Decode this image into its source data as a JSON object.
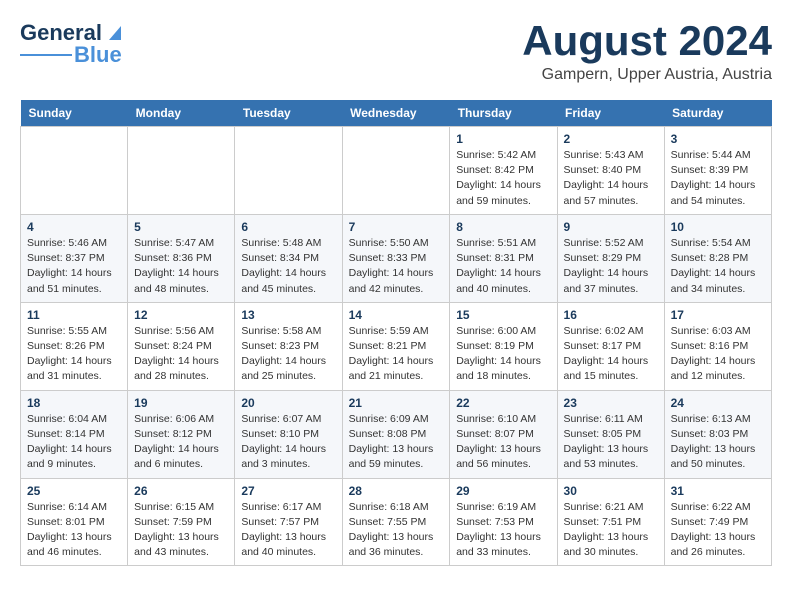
{
  "header": {
    "logo_general": "General",
    "logo_blue": "Blue",
    "month_title": "August 2024",
    "location": "Gampern, Upper Austria, Austria"
  },
  "calendar": {
    "weekdays": [
      "Sunday",
      "Monday",
      "Tuesday",
      "Wednesday",
      "Thursday",
      "Friday",
      "Saturday"
    ],
    "weeks": [
      [
        {
          "day": "",
          "sunrise": "",
          "sunset": "",
          "daylight": ""
        },
        {
          "day": "",
          "sunrise": "",
          "sunset": "",
          "daylight": ""
        },
        {
          "day": "",
          "sunrise": "",
          "sunset": "",
          "daylight": ""
        },
        {
          "day": "",
          "sunrise": "",
          "sunset": "",
          "daylight": ""
        },
        {
          "day": "1",
          "sunrise": "Sunrise: 5:42 AM",
          "sunset": "Sunset: 8:42 PM",
          "daylight": "Daylight: 14 hours and 59 minutes."
        },
        {
          "day": "2",
          "sunrise": "Sunrise: 5:43 AM",
          "sunset": "Sunset: 8:40 PM",
          "daylight": "Daylight: 14 hours and 57 minutes."
        },
        {
          "day": "3",
          "sunrise": "Sunrise: 5:44 AM",
          "sunset": "Sunset: 8:39 PM",
          "daylight": "Daylight: 14 hours and 54 minutes."
        }
      ],
      [
        {
          "day": "4",
          "sunrise": "Sunrise: 5:46 AM",
          "sunset": "Sunset: 8:37 PM",
          "daylight": "Daylight: 14 hours and 51 minutes."
        },
        {
          "day": "5",
          "sunrise": "Sunrise: 5:47 AM",
          "sunset": "Sunset: 8:36 PM",
          "daylight": "Daylight: 14 hours and 48 minutes."
        },
        {
          "day": "6",
          "sunrise": "Sunrise: 5:48 AM",
          "sunset": "Sunset: 8:34 PM",
          "daylight": "Daylight: 14 hours and 45 minutes."
        },
        {
          "day": "7",
          "sunrise": "Sunrise: 5:50 AM",
          "sunset": "Sunset: 8:33 PM",
          "daylight": "Daylight: 14 hours and 42 minutes."
        },
        {
          "day": "8",
          "sunrise": "Sunrise: 5:51 AM",
          "sunset": "Sunset: 8:31 PM",
          "daylight": "Daylight: 14 hours and 40 minutes."
        },
        {
          "day": "9",
          "sunrise": "Sunrise: 5:52 AM",
          "sunset": "Sunset: 8:29 PM",
          "daylight": "Daylight: 14 hours and 37 minutes."
        },
        {
          "day": "10",
          "sunrise": "Sunrise: 5:54 AM",
          "sunset": "Sunset: 8:28 PM",
          "daylight": "Daylight: 14 hours and 34 minutes."
        }
      ],
      [
        {
          "day": "11",
          "sunrise": "Sunrise: 5:55 AM",
          "sunset": "Sunset: 8:26 PM",
          "daylight": "Daylight: 14 hours and 31 minutes."
        },
        {
          "day": "12",
          "sunrise": "Sunrise: 5:56 AM",
          "sunset": "Sunset: 8:24 PM",
          "daylight": "Daylight: 14 hours and 28 minutes."
        },
        {
          "day": "13",
          "sunrise": "Sunrise: 5:58 AM",
          "sunset": "Sunset: 8:23 PM",
          "daylight": "Daylight: 14 hours and 25 minutes."
        },
        {
          "day": "14",
          "sunrise": "Sunrise: 5:59 AM",
          "sunset": "Sunset: 8:21 PM",
          "daylight": "Daylight: 14 hours and 21 minutes."
        },
        {
          "day": "15",
          "sunrise": "Sunrise: 6:00 AM",
          "sunset": "Sunset: 8:19 PM",
          "daylight": "Daylight: 14 hours and 18 minutes."
        },
        {
          "day": "16",
          "sunrise": "Sunrise: 6:02 AM",
          "sunset": "Sunset: 8:17 PM",
          "daylight": "Daylight: 14 hours and 15 minutes."
        },
        {
          "day": "17",
          "sunrise": "Sunrise: 6:03 AM",
          "sunset": "Sunset: 8:16 PM",
          "daylight": "Daylight: 14 hours and 12 minutes."
        }
      ],
      [
        {
          "day": "18",
          "sunrise": "Sunrise: 6:04 AM",
          "sunset": "Sunset: 8:14 PM",
          "daylight": "Daylight: 14 hours and 9 minutes."
        },
        {
          "day": "19",
          "sunrise": "Sunrise: 6:06 AM",
          "sunset": "Sunset: 8:12 PM",
          "daylight": "Daylight: 14 hours and 6 minutes."
        },
        {
          "day": "20",
          "sunrise": "Sunrise: 6:07 AM",
          "sunset": "Sunset: 8:10 PM",
          "daylight": "Daylight: 14 hours and 3 minutes."
        },
        {
          "day": "21",
          "sunrise": "Sunrise: 6:09 AM",
          "sunset": "Sunset: 8:08 PM",
          "daylight": "Daylight: 13 hours and 59 minutes."
        },
        {
          "day": "22",
          "sunrise": "Sunrise: 6:10 AM",
          "sunset": "Sunset: 8:07 PM",
          "daylight": "Daylight: 13 hours and 56 minutes."
        },
        {
          "day": "23",
          "sunrise": "Sunrise: 6:11 AM",
          "sunset": "Sunset: 8:05 PM",
          "daylight": "Daylight: 13 hours and 53 minutes."
        },
        {
          "day": "24",
          "sunrise": "Sunrise: 6:13 AM",
          "sunset": "Sunset: 8:03 PM",
          "daylight": "Daylight: 13 hours and 50 minutes."
        }
      ],
      [
        {
          "day": "25",
          "sunrise": "Sunrise: 6:14 AM",
          "sunset": "Sunset: 8:01 PM",
          "daylight": "Daylight: 13 hours and 46 minutes."
        },
        {
          "day": "26",
          "sunrise": "Sunrise: 6:15 AM",
          "sunset": "Sunset: 7:59 PM",
          "daylight": "Daylight: 13 hours and 43 minutes."
        },
        {
          "day": "27",
          "sunrise": "Sunrise: 6:17 AM",
          "sunset": "Sunset: 7:57 PM",
          "daylight": "Daylight: 13 hours and 40 minutes."
        },
        {
          "day": "28",
          "sunrise": "Sunrise: 6:18 AM",
          "sunset": "Sunset: 7:55 PM",
          "daylight": "Daylight: 13 hours and 36 minutes."
        },
        {
          "day": "29",
          "sunrise": "Sunrise: 6:19 AM",
          "sunset": "Sunset: 7:53 PM",
          "daylight": "Daylight: 13 hours and 33 minutes."
        },
        {
          "day": "30",
          "sunrise": "Sunrise: 6:21 AM",
          "sunset": "Sunset: 7:51 PM",
          "daylight": "Daylight: 13 hours and 30 minutes."
        },
        {
          "day": "31",
          "sunrise": "Sunrise: 6:22 AM",
          "sunset": "Sunset: 7:49 PM",
          "daylight": "Daylight: 13 hours and 26 minutes."
        }
      ]
    ]
  }
}
